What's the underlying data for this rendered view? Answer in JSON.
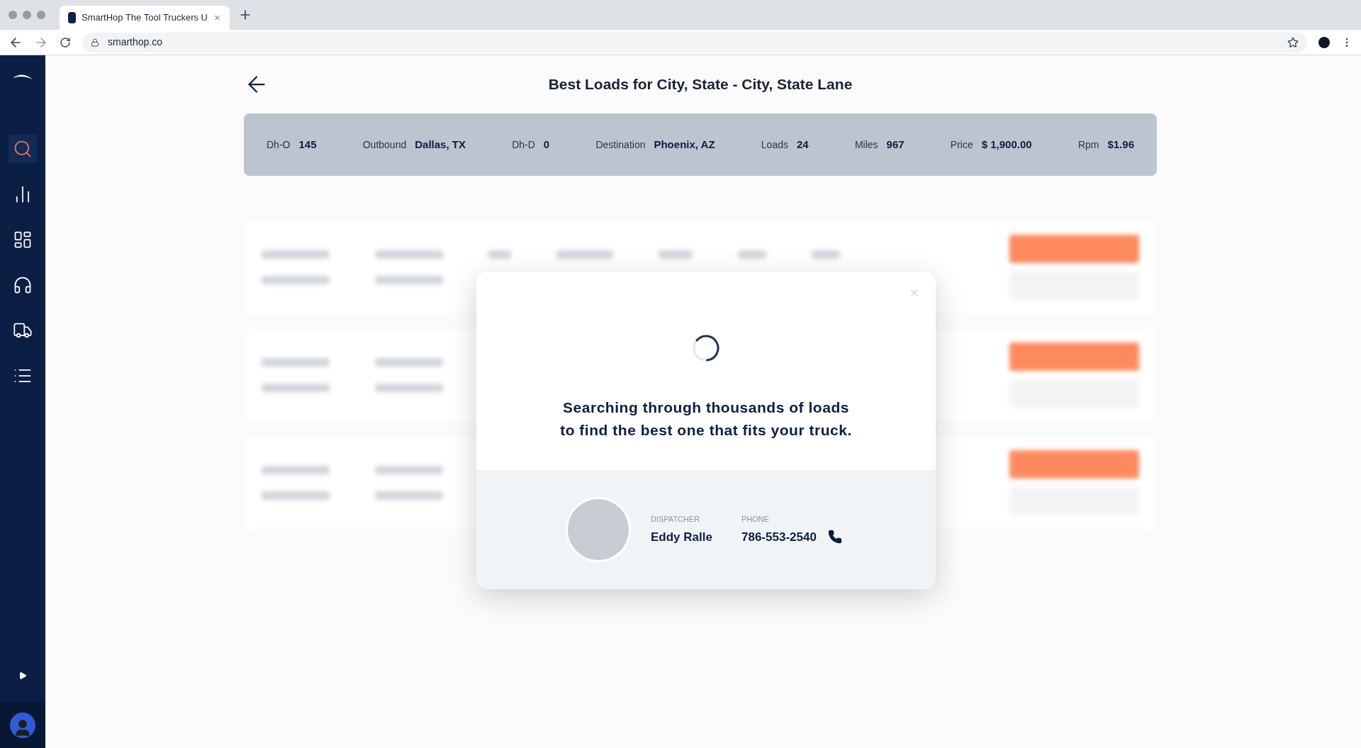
{
  "browser": {
    "tab_title": "SmartHop The Tool Truckers U",
    "url": "smarthop.co"
  },
  "sidebar": {
    "items": [
      {
        "kind": "search",
        "selected": true
      },
      {
        "kind": "chart",
        "selected": false
      },
      {
        "kind": "dashboard",
        "selected": false
      },
      {
        "kind": "support",
        "selected": false
      },
      {
        "kind": "truck",
        "selected": false
      },
      {
        "kind": "list",
        "selected": false
      }
    ]
  },
  "header": {
    "title": "Best Loads for City, State - City, State Lane"
  },
  "summary": [
    {
      "label": "Dh-O",
      "value": "145"
    },
    {
      "label": "Outbound",
      "value": "Dallas, TX"
    },
    {
      "label": "Dh-D",
      "value": "0"
    },
    {
      "label": "Destination",
      "value": "Phoenix, AZ"
    },
    {
      "label": "Loads",
      "value": "24"
    },
    {
      "label": "Miles",
      "value": "967"
    },
    {
      "label": "Price",
      "value": "$ 1,900.00"
    },
    {
      "label": "Rpm",
      "value": "$1.96"
    }
  ],
  "modal": {
    "message_lines": [
      "Searching through thousands of loads",
      "to find the best one that fits your truck."
    ],
    "dispatcher_label": "DISPATCHER",
    "dispatcher_name": "Eddy Ralle",
    "phone_label": "PHONE",
    "phone": "786-553-2540"
  }
}
